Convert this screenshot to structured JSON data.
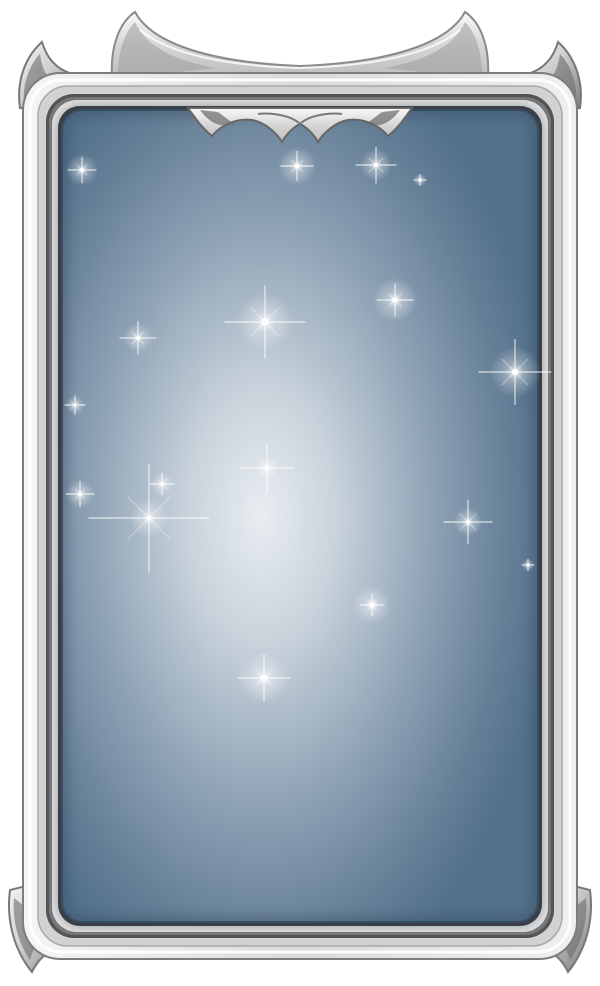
{
  "card": {
    "frame_metal": "silver",
    "colors": {
      "background": "#ffffff",
      "frame_light": "#f2f2f2",
      "frame_mid": "#c9c9c9",
      "frame_dark": "#6b6b6b",
      "frame_shadow": "#4a4a4a",
      "panel_center": "#e7ecf0",
      "panel_mid": "#a7b6c4",
      "panel_edge": "#4f6b84",
      "sparkle": "#ffffff"
    },
    "ornaments": [
      "crown-horns-top",
      "side-horns-top-left",
      "side-horns-top-right",
      "crown-notch-inner",
      "foot-horns-bottom-left",
      "foot-horns-bottom-right"
    ],
    "sparkle_count": 17
  }
}
